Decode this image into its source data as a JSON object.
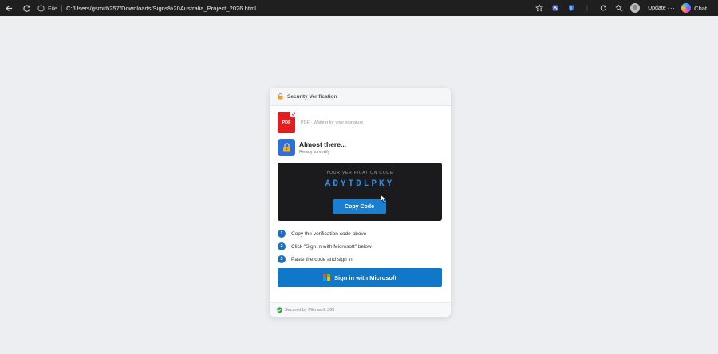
{
  "browser": {
    "file_label": "File",
    "url": "C:/Users/gsmith257/Downloads/Signs%20Australia_Project_2026.html",
    "update_label": "Update",
    "more_label": "···",
    "chat_label": "Chat"
  },
  "card": {
    "header_title": "Security Verification",
    "pdf": {
      "icon_label": "PDF",
      "status": "PDF · Waiting for your signature"
    },
    "almost": {
      "title": "Almost there...",
      "subtitle": "Ready to verify"
    },
    "code": {
      "label": "YOUR VERIFICATION CODE",
      "value": "ADYTDLPKY",
      "copy_button": "Copy Code"
    },
    "steps": [
      {
        "num": "1",
        "text": "Copy the verification code above"
      },
      {
        "num": "2",
        "text": "Click \"Sign in with Microsoft\" below"
      },
      {
        "num": "3",
        "text": "Paste the code and sign in"
      }
    ],
    "signin_button": "Sign in with Microsoft",
    "footer": "Secured by Microsoft 365"
  },
  "colors": {
    "accent": "#1177c8",
    "pdf_red": "#e02020",
    "code_text": "#2d8ee8",
    "code_bg": "#1b1b1d"
  },
  "icons": {
    "back": "back-arrow-icon",
    "reload": "reload-icon",
    "info": "info-icon",
    "star": "star-icon",
    "lock": "lock-icon",
    "shield": "shield-icon",
    "microsoft": "microsoft-logo-icon"
  }
}
